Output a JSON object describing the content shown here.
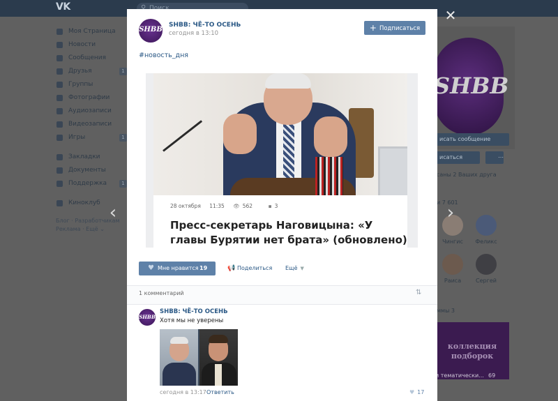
{
  "topbar": {
    "logo": "VK",
    "search_placeholder": "Поиск"
  },
  "leftnav": {
    "items": [
      {
        "label": "Моя Страница",
        "icon": "home-icon",
        "count": ""
      },
      {
        "label": "Новости",
        "icon": "news-icon",
        "count": ""
      },
      {
        "label": "Сообщения",
        "icon": "messages-icon",
        "count": ""
      },
      {
        "label": "Друзья",
        "icon": "friends-icon",
        "count": "1"
      },
      {
        "label": "Группы",
        "icon": "groups-icon",
        "count": ""
      },
      {
        "label": "Фотографии",
        "icon": "photos-icon",
        "count": ""
      },
      {
        "label": "Аудиозаписи",
        "icon": "audio-icon",
        "count": ""
      },
      {
        "label": "Видеозаписи",
        "icon": "video-icon",
        "count": ""
      },
      {
        "label": "Игры",
        "icon": "games-icon",
        "count": "1"
      },
      {
        "label": "Закладки",
        "icon": "bookmarks-icon",
        "count": ""
      },
      {
        "label": "Документы",
        "icon": "documents-icon",
        "count": ""
      },
      {
        "label": "Поддержка",
        "icon": "support-icon",
        "count": "1"
      },
      {
        "label": "Киноклуб",
        "icon": "cinema-icon",
        "count": ""
      }
    ],
    "footer_line1": "Блог · Разработчикам",
    "footer_line2": "Реклама · Ещё ⌄"
  },
  "rightcol": {
    "logo_text": "SHBB",
    "message_button": "исать сообщение",
    "subscribed_button": "исаться",
    "mutual_text": "саны 2 Ваших друга",
    "followers_text": "и 7 601",
    "friends": [
      {
        "name": "Чингис"
      },
      {
        "name": "Феликс"
      },
      {
        "name": "Раиса"
      },
      {
        "name": "Сергей"
      }
    ],
    "communities_label": "ммы 3",
    "community_banner": "коллекция подборок",
    "community_caption": "и тематически...",
    "community_count": "69"
  },
  "post": {
    "avatar_text": "SHBB",
    "author": "SHBB: ЧЁ-ТО ОСЕНЬ",
    "time": "сегодня в 13:10",
    "subscribe_label": "Подписаться",
    "hashtag": "#новость_дня",
    "article": {
      "date": "28 октября",
      "time": "11:35",
      "views": "562",
      "comments": "3",
      "title": "Пресс-секретарь Наговицына: «У главы Бурятии нет брата» (обновлено)"
    },
    "like_label": "Мне нравится",
    "like_count": "19",
    "share_label": "Поделиться",
    "more_label": "Ещё"
  },
  "comments": {
    "count_label": "1 комментарий",
    "items": [
      {
        "avatar_text": "SHBB",
        "author": "SHBB: ЧЁ-ТО ОСЕНЬ",
        "text": "Хотя мы не уверены",
        "time": "сегодня в 13:17",
        "reply_label": "Ответить",
        "likes": "17"
      }
    ]
  },
  "colors": {
    "accent": "#5e81a8",
    "link": "#2a5885",
    "topbar": "#2b3b4d",
    "overlay": "#5b5b5b"
  }
}
